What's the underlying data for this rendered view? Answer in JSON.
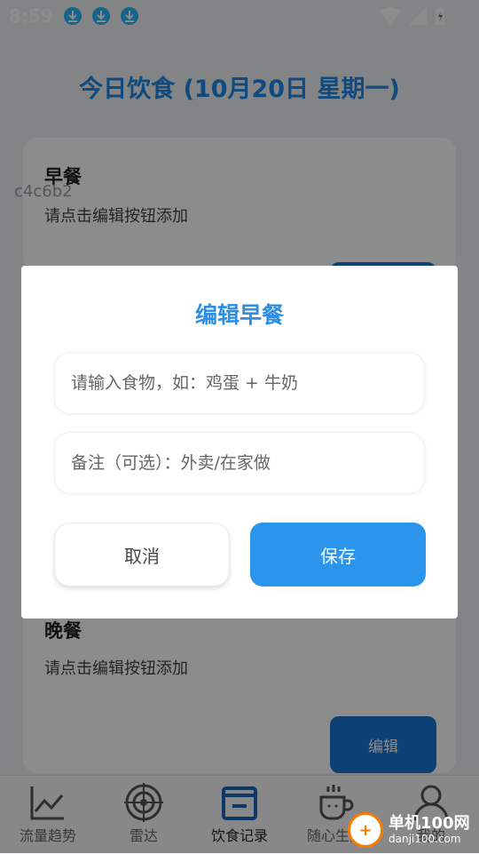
{
  "status_bar": {
    "time": "8:59"
  },
  "page": {
    "title": "今日饮食 (10月20日 星期一)",
    "watermark": "c4c6b2"
  },
  "meals": [
    {
      "title": "早餐",
      "text": "请点击编辑按钮添加"
    },
    {
      "title": "晚餐",
      "text": "请点击编辑按钮添加",
      "edit_label": "编辑"
    }
  ],
  "dialog": {
    "title": "编辑早餐",
    "food_placeholder": "请输入食物，如：鸡蛋 + 牛奶",
    "note_placeholder": "备注（可选）：外卖/在家做",
    "cancel_label": "取消",
    "save_label": "保存"
  },
  "bottom_nav": {
    "items": [
      {
        "label": "流量趋势",
        "icon": "trend-chart-icon"
      },
      {
        "label": "雷达",
        "icon": "radar-icon"
      },
      {
        "label": "饮食记录",
        "icon": "food-box-icon",
        "active": true
      },
      {
        "label": "随心生活",
        "icon": "coffee-cup-icon"
      },
      {
        "label": "我的",
        "icon": "user-icon"
      }
    ]
  },
  "site_badge": {
    "name": "单机100网",
    "url": "danji100.com"
  },
  "colors": {
    "accent": "#2b95ee",
    "title_blue": "#1e88e5",
    "active_nav": "#1565c0"
  }
}
